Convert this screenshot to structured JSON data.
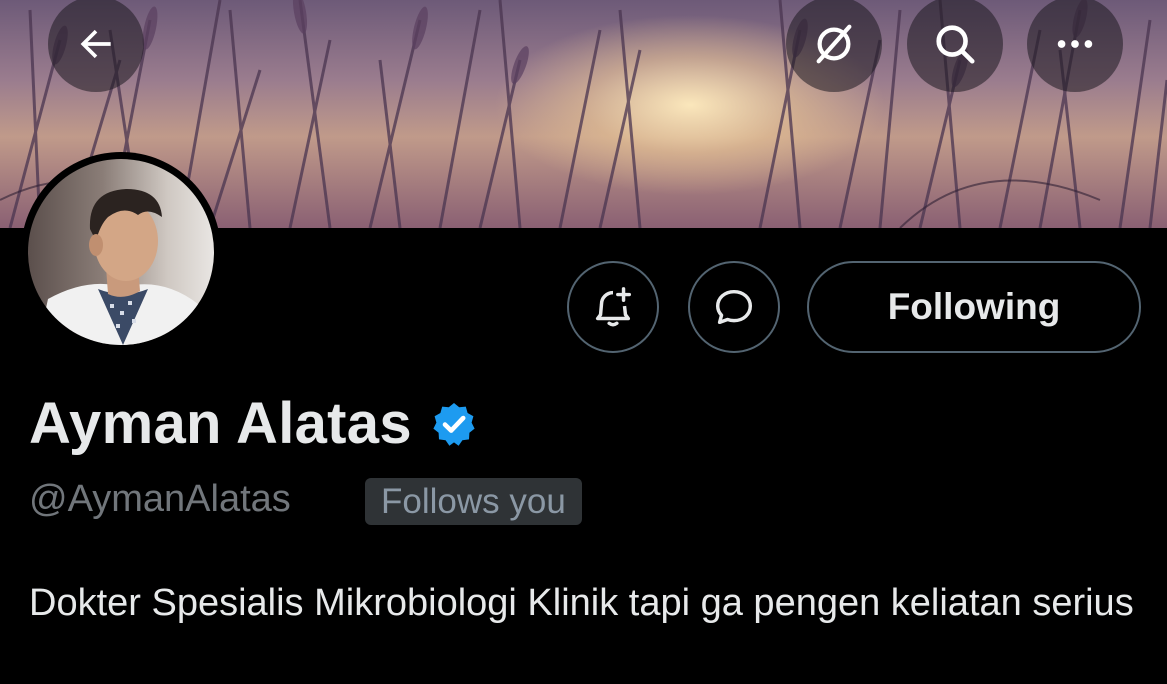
{
  "banner": {
    "description_icon": "wheat-field-sunset"
  },
  "topbar": {
    "back_icon": "arrow-left-icon",
    "grok_icon": "grok-icon",
    "search_icon": "search-icon",
    "more_icon": "more-icon"
  },
  "profile": {
    "name": "Ayman Alatas",
    "verified": true,
    "verified_color": "#1d9bf0",
    "handle": "@AymanAlatas",
    "follows_you_badge": "Follows you",
    "bio": "Dokter Spesialis Mikrobiologi Klinik tapi ga pengen keliatan serius"
  },
  "actions": {
    "notify_icon": "bell-plus-icon",
    "message_icon": "message-icon",
    "following_label": "Following"
  }
}
